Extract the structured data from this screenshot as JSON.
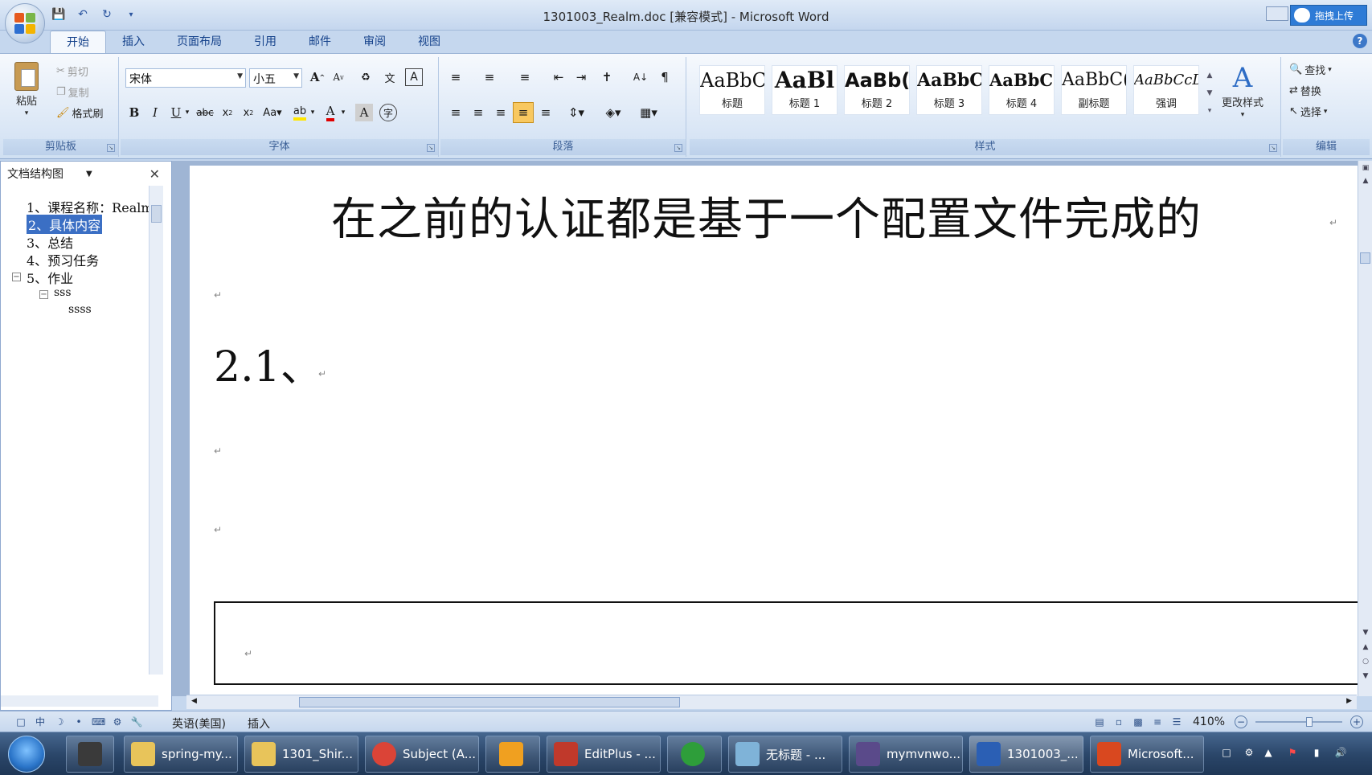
{
  "window": {
    "title": "1301003_Realm.doc [兼容模式] - Microsoft Word",
    "upload_label": "拖拽上传"
  },
  "ribbon": {
    "tabs": [
      "开始",
      "插入",
      "页面布局",
      "引用",
      "邮件",
      "审阅",
      "视图"
    ],
    "active_tab": "开始",
    "clipboard": {
      "label": "剪贴板",
      "paste": "粘贴",
      "cut": "剪切",
      "copy": "复制",
      "format_painter": "格式刷"
    },
    "font": {
      "label": "字体",
      "font_name": "宋体",
      "font_size": "小五"
    },
    "paragraph": {
      "label": "段落"
    },
    "styles": {
      "label": "样式",
      "items": [
        {
          "sample": "AaBbC(",
          "name": "标题"
        },
        {
          "sample": "AaBl",
          "name": "标题 1"
        },
        {
          "sample": "AaBb(",
          "name": "标题 2"
        },
        {
          "sample": "AaBbC(",
          "name": "标题 3"
        },
        {
          "sample": "AaBbC(",
          "name": "标题 4"
        },
        {
          "sample": "AaBbC(",
          "name": "副标题"
        },
        {
          "sample": "AaBbCcDı",
          "name": "强调"
        }
      ],
      "change_styles": "更改样式"
    },
    "editing": {
      "label": "编辑",
      "find": "查找",
      "replace": "替换",
      "select": "选择"
    }
  },
  "docmap": {
    "title": "文档结构图",
    "items": [
      "1、课程名称：Realm",
      "2、具体内容",
      "3、总结",
      "4、预习任务",
      "5、作业",
      "sss",
      "ssss"
    ],
    "selected_index": 1
  },
  "document": {
    "heading": "在之前的认证都是基于一个配置文件完成的",
    "section": "2.1、",
    "para_mark": "↵"
  },
  "statusbar": {
    "language": "英语(美国)",
    "mode": "插入",
    "zoom": "410%",
    "zoom_fraction": 0.62
  },
  "taskbar": {
    "items": [
      {
        "label": "spring-my...",
        "icon_color": "#e8c45a"
      },
      {
        "label": "1301_Shir...",
        "icon_color": "#e8c45a"
      },
      {
        "label": "Subject (A...",
        "icon_color": "#db4437"
      },
      {
        "label": "",
        "icon_color": "#f0a020"
      },
      {
        "label": "EditPlus - ...",
        "icon_color": "#c0392b"
      },
      {
        "label": "",
        "icon_color": "#2e9e3a"
      },
      {
        "label": "无标题 - ...",
        "icon_color": "#7fb3d8"
      },
      {
        "label": "mymvnwo...",
        "icon_color": "#5a4a8a"
      },
      {
        "label": "1301003_...",
        "icon_color": "#2b5fb4"
      },
      {
        "label": "Microsoft...",
        "icon_color": "#d9481f"
      }
    ]
  },
  "colors": {
    "accent": "#3b6fc4",
    "ribbon_text": "#15428b"
  }
}
